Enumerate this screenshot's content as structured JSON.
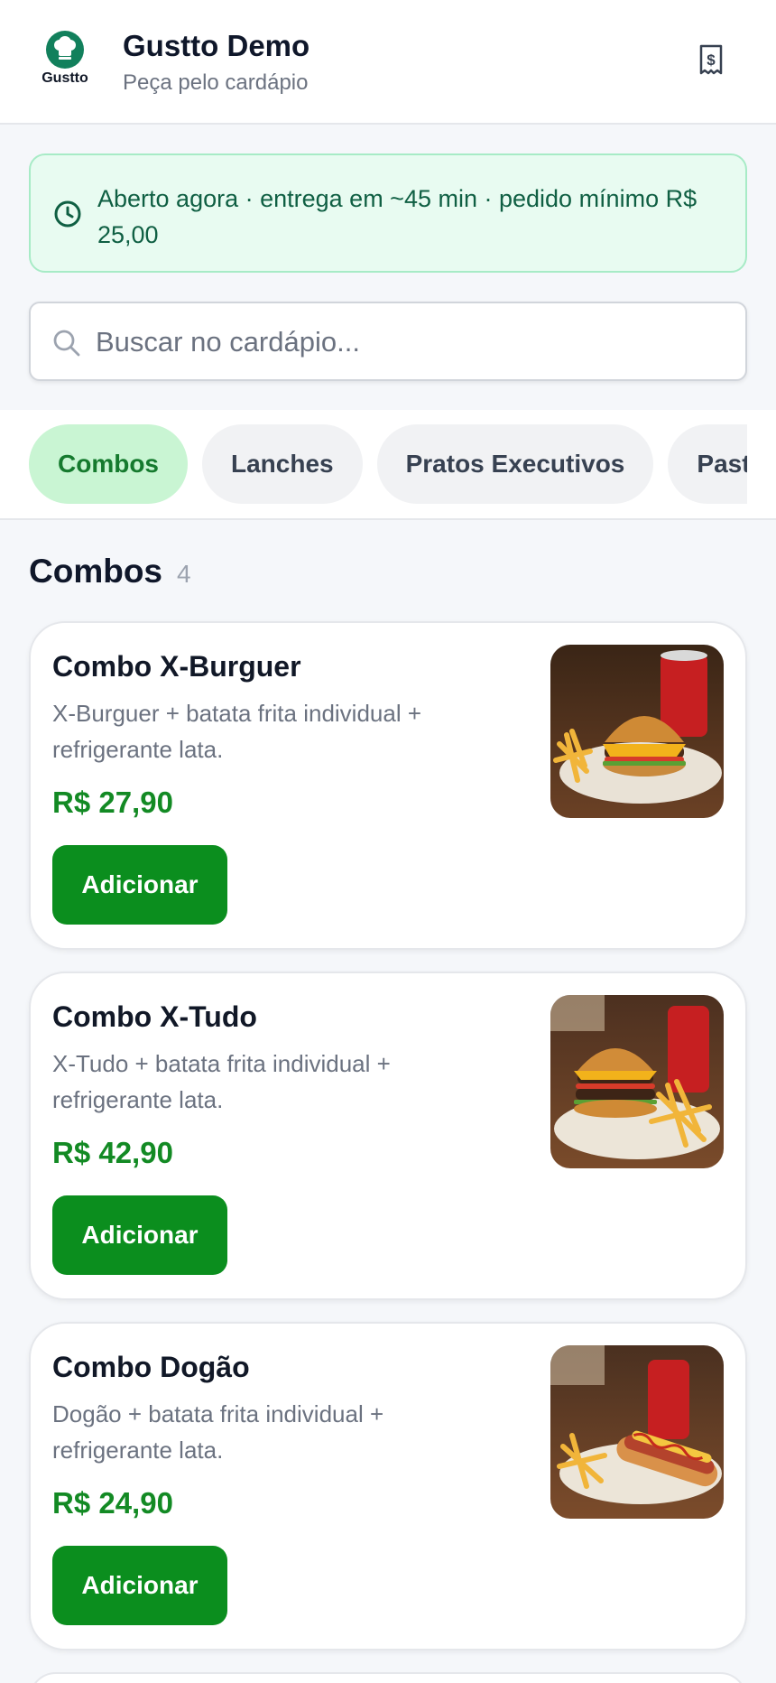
{
  "header": {
    "logo_text": "Gustto",
    "store_name": "Gustto Demo",
    "subtitle": "Peça pelo cardápio",
    "receipt_icon": "receipt-icon"
  },
  "status": {
    "icon": "clock-icon",
    "text": "Aberto agora · entrega em ~45 min · pedido mínimo R$ 25,00"
  },
  "search": {
    "placeholder": "Buscar no cardápio...",
    "value": "",
    "icon": "search-icon"
  },
  "categories": [
    {
      "label": "Combos",
      "active": true
    },
    {
      "label": "Lanches",
      "active": false
    },
    {
      "label": "Pratos Executivos",
      "active": false
    },
    {
      "label": "Pastéis",
      "active": false
    }
  ],
  "section": {
    "title": "Combos",
    "count": "4"
  },
  "items": [
    {
      "name": "Combo X-Burguer",
      "description": "X-Burguer + batata frita individual + refrigerante lata.",
      "price": "R$ 27,90",
      "button": "Adicionar",
      "image": "burger-combo-photo"
    },
    {
      "name": "Combo X-Tudo",
      "description": "X-Tudo + batata frita individual + refrigerante lata.",
      "price": "R$ 42,90",
      "button": "Adicionar",
      "image": "xtudo-combo-photo"
    },
    {
      "name": "Combo Dogão",
      "description": "Dogão + batata frita individual + refrigerante lata.",
      "price": "R$ 24,90",
      "button": "Adicionar",
      "image": "hotdog-combo-photo"
    }
  ],
  "colors": {
    "primary": "#0b8e1e",
    "price": "#138a24",
    "brand": "#12805c",
    "chip_active_bg": "#c9f5d3",
    "status_bg": "#e8fbf1"
  }
}
